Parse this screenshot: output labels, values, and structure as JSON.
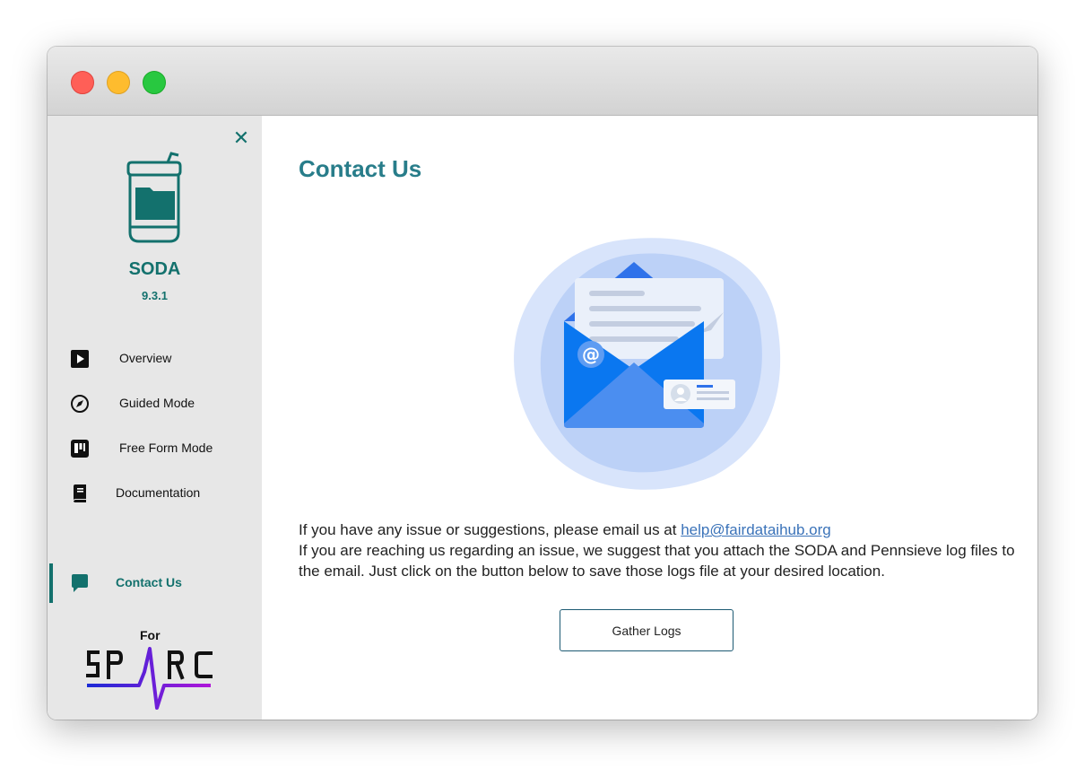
{
  "sidebar": {
    "app_name": "SODA",
    "version": "9.3.1",
    "items": [
      {
        "label": "Overview",
        "icon": "play-icon"
      },
      {
        "label": "Guided Mode",
        "icon": "compass-icon"
      },
      {
        "label": "Free Form Mode",
        "icon": "kanban-icon"
      },
      {
        "label": "Documentation",
        "icon": "book-icon"
      },
      {
        "label": "Contact Us",
        "icon": "chat-icon",
        "active": true
      }
    ],
    "for_label": "For",
    "brand": "SPARC"
  },
  "main": {
    "title": "Contact Us",
    "line1": "If you have any issue or suggestions, please email us at ",
    "email": "help@fairdataihub.org",
    "line2": "If you are reaching us regarding an issue, we suggest that you attach the SODA and Pennsieve log files to the email. Just click on the button below to save those logs file at your desired location.",
    "button_label": "Gather Logs"
  },
  "colors": {
    "accent": "#13716d",
    "title": "#287d8a",
    "link": "#3b73b9"
  }
}
